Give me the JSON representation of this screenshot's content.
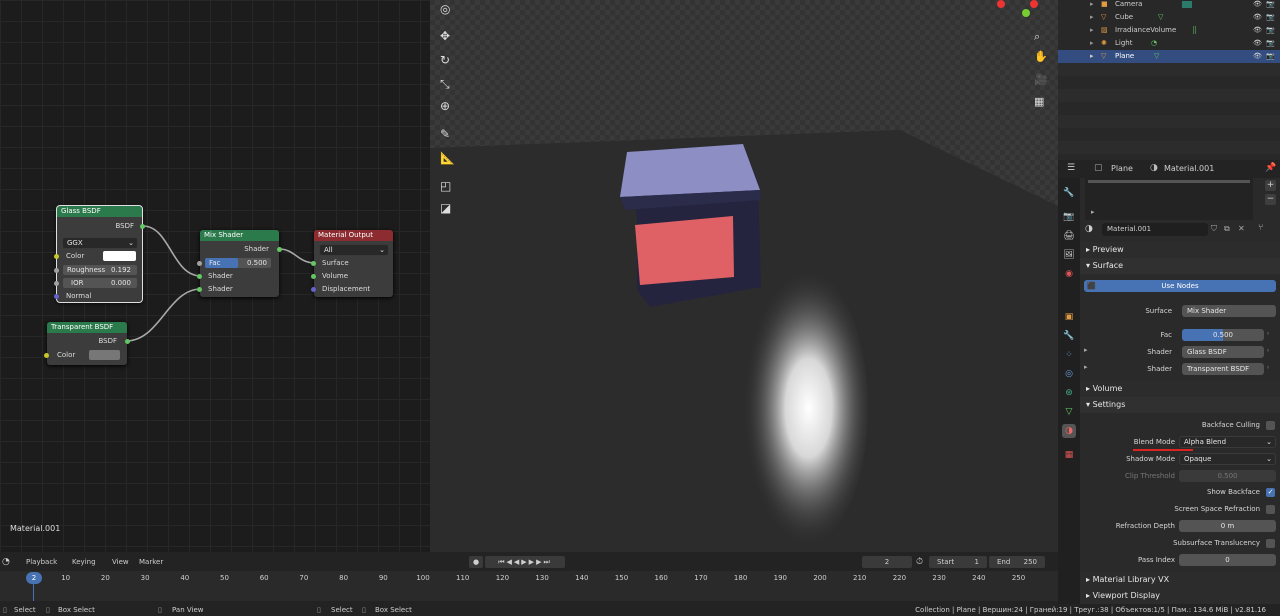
{
  "node_editor": {
    "material_label": "Material.001",
    "glass": {
      "title": "Glass BSDF",
      "out": "BSDF",
      "dist": "GGX",
      "color": "Color",
      "roughness_label": "Roughness",
      "roughness": "0.192",
      "ior_label": "IOR",
      "ior": "0.000",
      "normal": "Normal"
    },
    "transparent": {
      "title": "Transparent BSDF",
      "out": "BSDF",
      "color": "Color"
    },
    "mix": {
      "title": "Mix Shader",
      "out": "Shader",
      "fac_label": "Fac",
      "fac": "0.500",
      "shader1": "Shader",
      "shader2": "Shader"
    },
    "output": {
      "title": "Material Output",
      "target": "All",
      "surface": "Surface",
      "volume": "Volume",
      "displacement": "Displacement"
    }
  },
  "outliner": {
    "items": [
      {
        "name": "Camera",
        "icon": "camera-icon"
      },
      {
        "name": "Cube",
        "icon": "mesh-icon"
      },
      {
        "name": "IrradianceVolume",
        "icon": "lightprobe-icon"
      },
      {
        "name": "Light",
        "icon": "light-icon"
      },
      {
        "name": "Plane",
        "icon": "mesh-icon",
        "selected": true
      }
    ]
  },
  "properties": {
    "object": "Plane",
    "material": "Material.001",
    "slot_material": "Material.001",
    "preview": "Preview",
    "surface_panel": "Surface",
    "use_nodes": "Use Nodes",
    "surface_label": "Surface",
    "surface_value": "Mix Shader",
    "fac_label": "Fac",
    "fac_value": "0.500",
    "fac_fraction": 0.5,
    "shader1_label": "Shader",
    "shader1_value": "Glass BSDF",
    "shader2_label": "Shader",
    "shader2_value": "Transparent BSDF",
    "volume_panel": "Volume",
    "settings_panel": "Settings",
    "backface_culling": "Backface Culling",
    "blend_mode_label": "Blend Mode",
    "blend_mode_value": "Alpha Blend",
    "shadow_mode_label": "Shadow Mode",
    "shadow_mode_value": "Opaque",
    "clip_label": "Clip Threshold",
    "clip_value": "0.500",
    "show_backface": "Show Backface",
    "ssr": "Screen Space Refraction",
    "refraction_depth_label": "Refraction Depth",
    "refraction_depth_value": "0 m",
    "subsurface": "Subsurface Translucency",
    "pass_index_label": "Pass Index",
    "pass_index_value": "0",
    "material_library": "Material Library VX",
    "viewport_display": "Viewport Display"
  },
  "timeline": {
    "playback": "Playback",
    "keying": "Keying",
    "view": "View",
    "marker": "Marker",
    "current_frame": "2",
    "start_label": "Start",
    "start": "1",
    "end_label": "End",
    "end": "250",
    "ticks": [
      "2",
      "10",
      "20",
      "30",
      "40",
      "50",
      "60",
      "70",
      "80",
      "90",
      "100",
      "110",
      "120",
      "130",
      "140",
      "150",
      "160",
      "170",
      "180",
      "190",
      "200",
      "210",
      "220",
      "230",
      "240",
      "250"
    ]
  },
  "statusbar": {
    "select": "Select",
    "box_select": "Box Select",
    "pan_view": "Pan View",
    "select2": "Select",
    "box_select2": "Box Select",
    "stats": "Collection | Plane | Вершин:24 | Граней:19 | Треуг.:38 | Объектов:1/5 | Пам.: 134.6 MiB | v2.81.16"
  },
  "colors": {
    "accent": "#4772b3",
    "selected_row": "#334d80",
    "cube_top": "#8d8fc4",
    "cube_face": "#e06165",
    "cube_side": "#24243f"
  }
}
